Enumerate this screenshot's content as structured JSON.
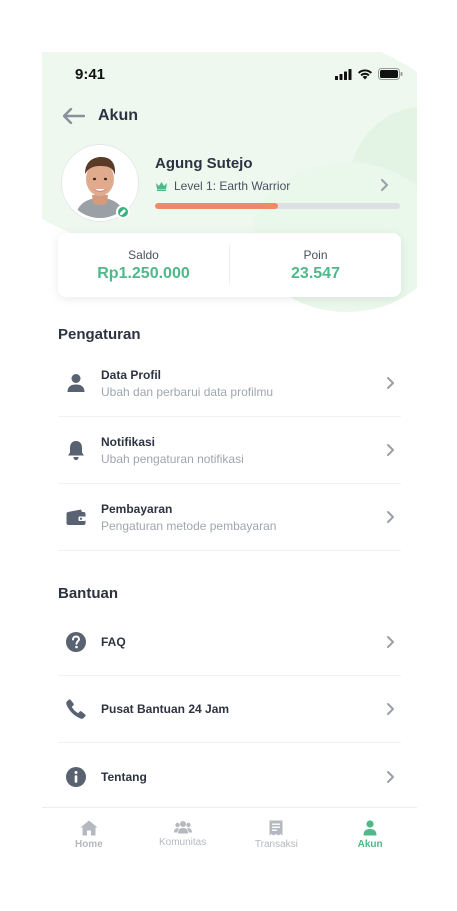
{
  "status_bar": {
    "time": "9:41"
  },
  "header": {
    "title": "Akun"
  },
  "profile": {
    "name": "Agung Sutejo",
    "level": "Level 1: Earth Warrior",
    "level_progress": 0.5
  },
  "balance": {
    "saldo_label": "Saldo",
    "saldo_value": "Rp1.250.000",
    "poin_label": "Poin",
    "poin_value": "23.547"
  },
  "settings": {
    "title": "Pengaturan",
    "items": [
      {
        "title": "Data Profil",
        "subtitle": "Ubah dan perbarui data profilmu",
        "icon": "user-icon"
      },
      {
        "title": "Notifikasi",
        "subtitle": "Ubah pengaturan notifikasi",
        "icon": "bell-icon"
      },
      {
        "title": "Pembayaran",
        "subtitle": "Pengaturan metode pembayaran",
        "icon": "wallet-icon"
      }
    ]
  },
  "help": {
    "title": "Bantuan",
    "items": [
      {
        "title": "FAQ",
        "icon": "question-icon"
      },
      {
        "title": "Pusat Bantuan 24 Jam",
        "icon": "phone-icon"
      },
      {
        "title": "Tentang",
        "icon": "info-icon"
      }
    ]
  },
  "nav": {
    "items": [
      {
        "label": "Home",
        "icon": "home-icon"
      },
      {
        "label": "Komunitas",
        "icon": "community-icon"
      },
      {
        "label": "Transaksi",
        "icon": "receipt-icon"
      },
      {
        "label": "Akun",
        "icon": "account-icon",
        "active": true
      }
    ]
  },
  "colors": {
    "accent": "#4fb889",
    "progress": "#ee8a65",
    "icon": "#596270"
  }
}
